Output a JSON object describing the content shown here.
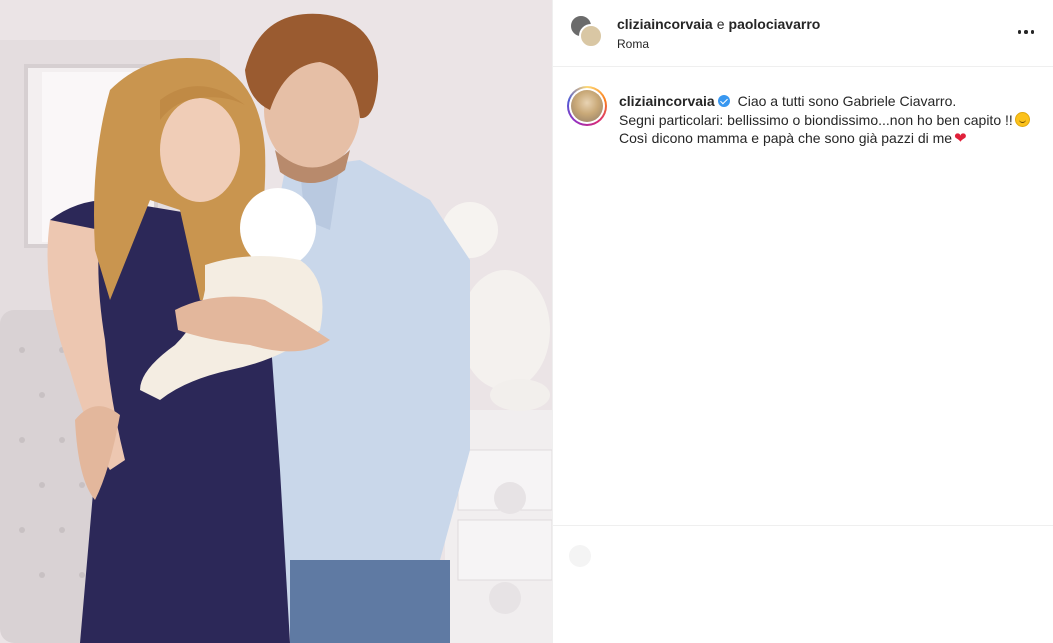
{
  "header": {
    "user1": "cliziaincorvaia",
    "separator": "e",
    "user2": "paolociavarro",
    "location": "Roma",
    "more_icon": "more-horizontal-icon"
  },
  "caption": {
    "username": "cliziaincorvaia",
    "verified_icon": "verified-badge-icon",
    "line1": "Ciao a tutti sono Gabriele Ciavarro.",
    "line2": "Segni particolari: bellissimo o biondissimo...non ho ben capito !!",
    "line2_emoji": "smiling-face-emoji",
    "line3": "Così dicono mamma e papà che sono già pazzi di me",
    "line3_emoji": "red-heart-emoji"
  },
  "colors": {
    "text": "#262626",
    "divider": "#efefef",
    "verified": "#3897f0",
    "heart": "#e0203a"
  }
}
